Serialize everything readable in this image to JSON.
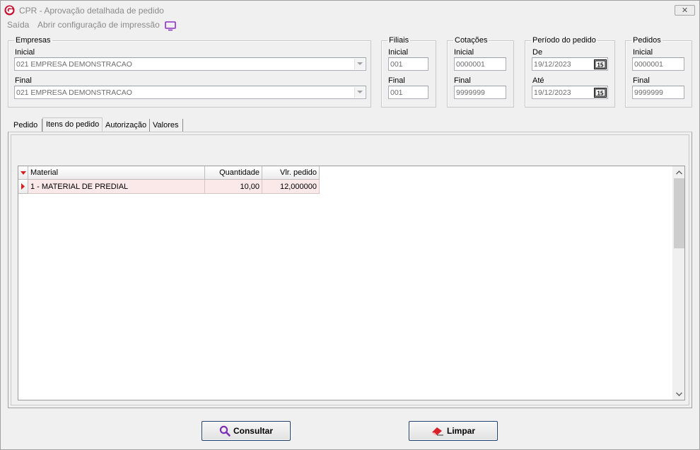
{
  "window": {
    "title": "CPR - Aprovação detalhada de pedido",
    "close_glyph": "✕"
  },
  "menu": {
    "items": [
      "Saída",
      "Abrir configuração de impressão"
    ],
    "icon": "monitor-icon"
  },
  "empresas": {
    "legend": "Empresas",
    "inicial_label": "Inicial",
    "inicial_value": "021 EMPRESA DEMONSTRACAO",
    "final_label": "Final",
    "final_value": "021 EMPRESA DEMONSTRACAO"
  },
  "filiais": {
    "legend": "Filiais",
    "inicial_label": "Inicial",
    "inicial_value": "001",
    "final_label": "Final",
    "final_value": "001"
  },
  "cotacoes": {
    "legend": "Cotações",
    "inicial_label": "Inicial",
    "inicial_value": "0000001",
    "final_label": "Final",
    "final_value": "9999999"
  },
  "periodo": {
    "legend": "Período do pedido",
    "de_label": "De",
    "de_value": "19/12/2023",
    "ate_label": "Até",
    "ate_value": "19/12/2023",
    "calendar_glyph": "15"
  },
  "pedidos": {
    "legend": "Pedidos",
    "inicial_label": "Inicial",
    "inicial_value": "0000001",
    "final_label": "Final",
    "final_value": "9999999"
  },
  "tabs": [
    {
      "label": "Pedido"
    },
    {
      "label": "Itens do pedido"
    },
    {
      "label": "Autorização"
    },
    {
      "label": "Valores"
    }
  ],
  "grid": {
    "columns": [
      "Material",
      "Quantidade",
      "Vlr. pedido"
    ],
    "rows": [
      {
        "material": "1 - MATERIAL DE PREDIAL",
        "quantidade": "10,00",
        "vlr_pedido": "12,000000"
      }
    ]
  },
  "buttons": {
    "consultar": "Consultar",
    "limpar": "Limpar"
  },
  "colors": {
    "row_highlight": "#fbe9e9",
    "indicator_red": "#d42020",
    "button_border": "#1e3e73",
    "consultar_icon": "#7a2fb4",
    "limpar_icon": "#d8202a"
  }
}
